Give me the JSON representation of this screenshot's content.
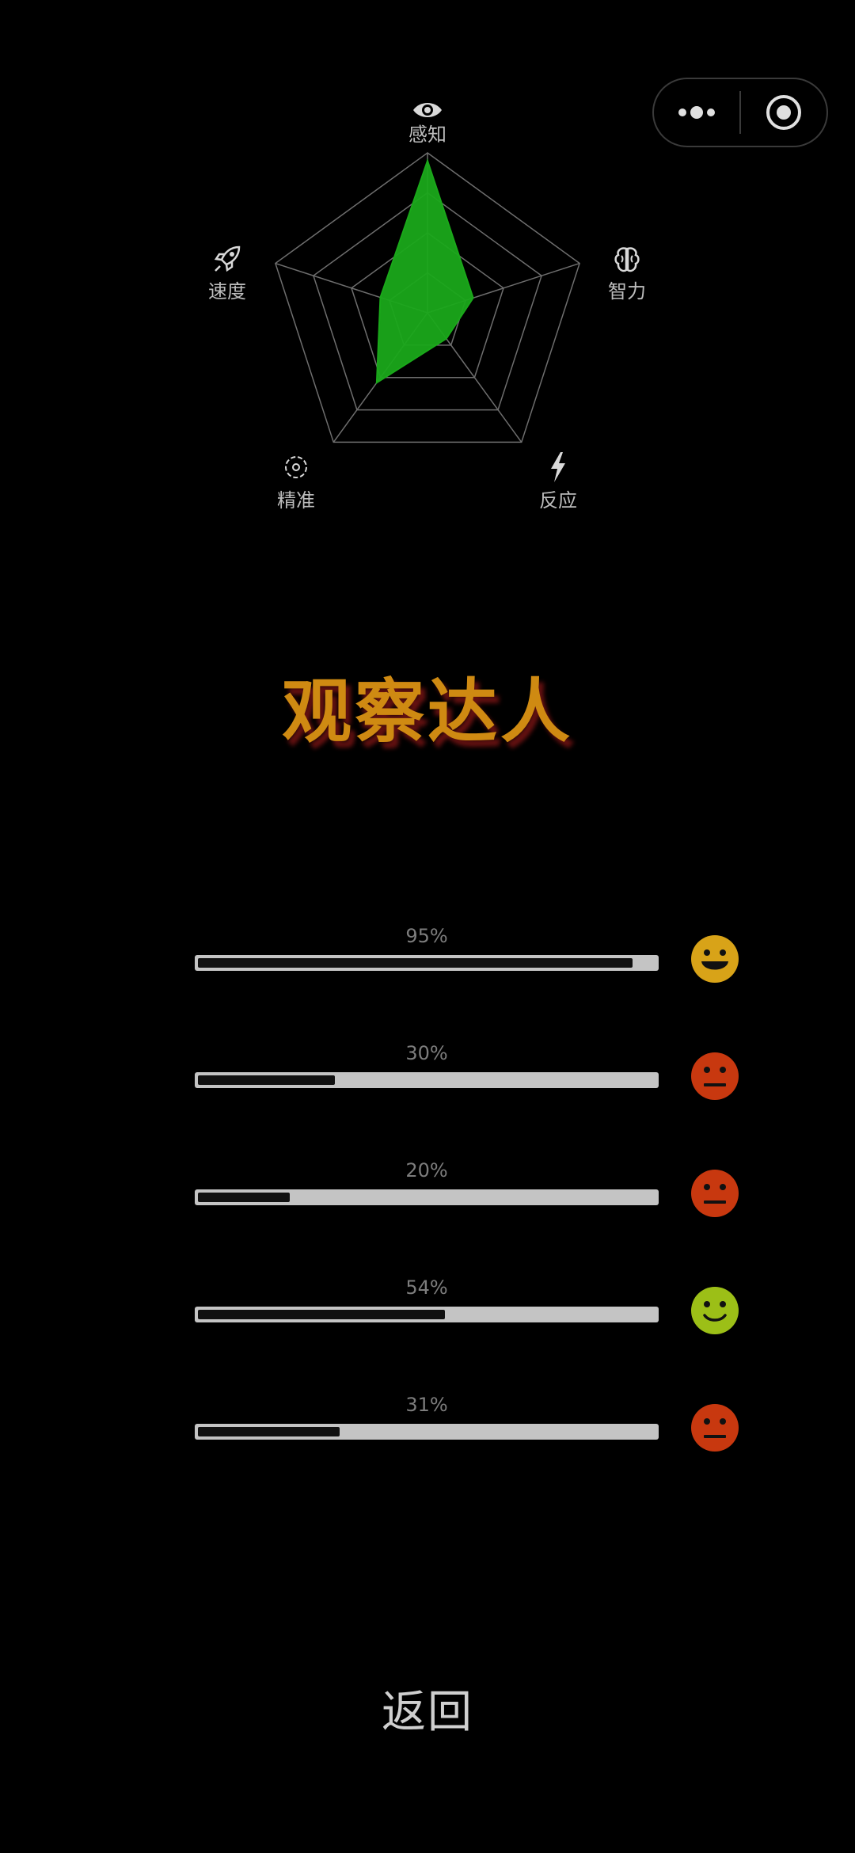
{
  "capsule": {
    "menu_icon": "more-dots-icon",
    "close_icon": "target-circle-icon"
  },
  "radar": {
    "labels": {
      "perception": "感知",
      "intelligence": "智力",
      "reaction": "反应",
      "precision": "精准",
      "speed": "速度"
    },
    "icons": {
      "perception": "eye-icon",
      "intelligence": "brain-icon",
      "reaction": "lightning-icon",
      "precision": "target-icon",
      "speed": "rocket-icon"
    },
    "values": {
      "perception": 0.95,
      "intelligence": 0.3,
      "reaction": 0.2,
      "precision": 0.54,
      "speed": 0.31
    },
    "levels": 4,
    "grid_color": "#6e6e6e",
    "fill_color": "#1aa81a"
  },
  "title": "观察达人",
  "rows": [
    {
      "percent": "95%",
      "value": 0.95,
      "mood": "grin",
      "color": "#d8a318"
    },
    {
      "percent": "30%",
      "value": 0.3,
      "mood": "neutral",
      "color": "#c8380f"
    },
    {
      "percent": "20%",
      "value": 0.2,
      "mood": "neutral",
      "color": "#c8380f"
    },
    {
      "percent": "54%",
      "value": 0.54,
      "mood": "smile",
      "color": "#9cbf17"
    },
    {
      "percent": "31%",
      "value": 0.31,
      "mood": "neutral",
      "color": "#c8380f"
    }
  ],
  "back_label": "返回"
}
